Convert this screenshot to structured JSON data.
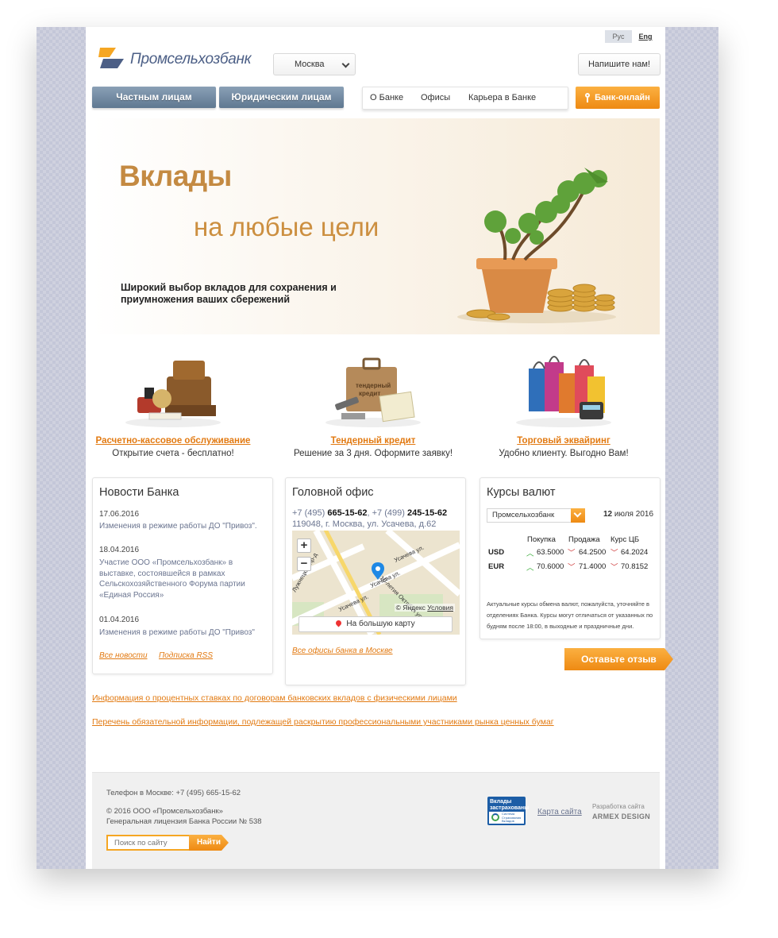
{
  "lang": {
    "ru": "Рус",
    "en": "Eng"
  },
  "logo": {
    "text": "Промсельхозбанк"
  },
  "city": {
    "selected": "Москва"
  },
  "header": {
    "write_us": "Напишите нам!"
  },
  "nav": {
    "private": "Частным лицам",
    "corporate": "Юридическим лицам",
    "items": [
      "О Банке",
      "Офисы",
      "Карьера в Банке"
    ],
    "online": "Банк-онлайн"
  },
  "banner": {
    "title_1": "Вклады",
    "title_2": "на любые цели",
    "subtitle": "Широкий выбор вкладов для сохранения и приумножения ваших сбережений"
  },
  "services": [
    {
      "link": "Расчетно-кассовое обслуживание",
      "desc": "Открытие счета - бесплатно!"
    },
    {
      "link": "Тендерный кредит",
      "desc": "Решение за 3 дня. Оформите заявку!"
    },
    {
      "link": "Торговый эквайринг",
      "desc": "Удобно клиенту. Выгодно Вам!"
    }
  ],
  "news": {
    "title": "Новости Банка",
    "items": [
      {
        "date": "17.06.2016",
        "text": "Изменения в режиме работы ДО \"Привоз\"."
      },
      {
        "date": "18.04.2016",
        "text": "Участие ООО «Промсельхозбанк» в выставке, состоявшейся в рамках Сельскохозяйственного Форума партии «Единая Россия»"
      },
      {
        "date": "01.04.2016",
        "text": "Изменения в режиме работы ДО \"Привоз\""
      }
    ],
    "all_link": "Все новости",
    "rss_link": "Подписка RSS"
  },
  "office": {
    "title": "Головной офис",
    "phone1_code": "+7 (495)",
    "phone1": "665-15-62",
    "phone2_code": "+7 (499)",
    "phone2": "245-15-62",
    "address": "119048, г. Москва, ул. Усачева, д.62",
    "map_button": "На большую карту",
    "map_copyright": "© Яндекс",
    "map_terms": "Условия",
    "zoom_in": "+",
    "zoom_out": "−",
    "streets": [
      "Усачева ул.",
      "Усачева ул.",
      "Усачёва ул.",
      "10-летия Октября ул.",
      "Лужнецкий пр-д"
    ],
    "all_offices_link": "Все офисы банка в Москве"
  },
  "rates": {
    "title": "Курсы валют",
    "bank_selected": "Промсельхозбанк",
    "date_day": "12",
    "date_rest": "июля 2016",
    "headers": [
      "Покупка",
      "Продажа",
      "Курс ЦБ"
    ],
    "rows": [
      {
        "currency": "USD",
        "buy": "63.5000",
        "sell": "64.2500",
        "cb": "64.2024",
        "buy_dir": "up",
        "sell_dir": "down",
        "cb_dir": "down"
      },
      {
        "currency": "EUR",
        "buy": "70.6000",
        "sell": "71.4000",
        "cb": "70.8152",
        "buy_dir": "up",
        "sell_dir": "down",
        "cb_dir": "down"
      }
    ],
    "note": "Актуальные курсы обмена валют, пожалуйста, уточняйте в отделениях Банка. Курсы могут отличаться от указанных по будням после 18:00, в выходные и праздничные дни."
  },
  "feedback_button": "Оставьте отзыв",
  "info_links": [
    "Информация о процентных ставках по договорам банковских вкладов с физическими лицами",
    "Перечень обязательной информации, подлежащей раскрытию профессиональными участниками рынка ценных бумаг"
  ],
  "footer": {
    "phone": "Телефон в Москве: +7 (495) 665-15-62",
    "copyright": "© 2016 ООО «Промсельхозбанк»",
    "license": "Генеральная лицензия Банка России № 538",
    "search_placeholder": "Поиск по сайту",
    "search_button": "Найти",
    "insured_label": "Вклады застрахованы",
    "insured_sub": "Система Страхования Вкладов",
    "sitemap": "Карта сайта",
    "dev_label": "Разработка сайта",
    "dev_name": "ARMEX DESIGN"
  },
  "colors": {
    "accent": "#ee8a13",
    "nav_blue": "#6f869e",
    "link_gray": "#6b7590"
  }
}
